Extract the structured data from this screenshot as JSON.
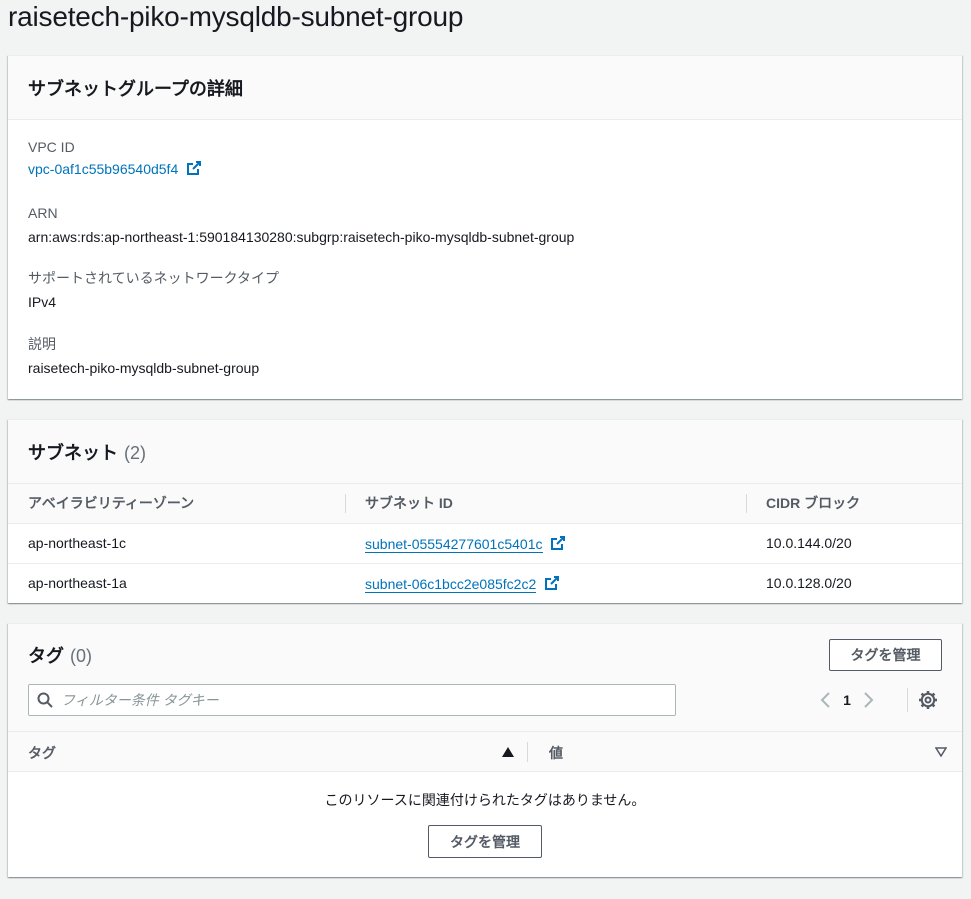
{
  "page": {
    "title": "raisetech-piko-mysqldb-subnet-group"
  },
  "details": {
    "title": "サブネットグループの詳細",
    "vpc_label": "VPC ID",
    "vpc_value": "vpc-0af1c55b96540d5f4",
    "arn_label": "ARN",
    "arn_value": "arn:aws:rds:ap-northeast-1:590184130280:subgrp:raisetech-piko-mysqldb-subnet-group",
    "network_label": "サポートされているネットワークタイプ",
    "network_value": "IPv4",
    "desc_label": "説明",
    "desc_value": "raisetech-piko-mysqldb-subnet-group"
  },
  "subnets": {
    "title": "サブネット",
    "count": "(2)",
    "columns": [
      "アベイラビリティーゾーン",
      "サブネット ID",
      "CIDR ブロック"
    ],
    "rows": [
      {
        "az": "ap-northeast-1c",
        "id": "subnet-05554277601c5401c",
        "cidr": "10.0.144.0/20"
      },
      {
        "az": "ap-northeast-1a",
        "id": "subnet-06c1bcc2e085fc2c2",
        "cidr": "10.0.128.0/20"
      }
    ]
  },
  "tags": {
    "title": "タグ",
    "count": "(0)",
    "manage_label": "タグを管理",
    "search_placeholder": "フィルター条件 タグキー",
    "page_number": "1",
    "col_key": "タグ",
    "col_value": "値",
    "empty_message": "このリソースに関連付けられたタグはありません。",
    "empty_manage_label": "タグを管理"
  },
  "icons": {
    "external": "external-link-icon",
    "search": "search-icon",
    "prev": "chevron-left-icon",
    "next": "chevron-right-icon",
    "settings": "gear-icon",
    "sort_up": "sort-ascending-icon",
    "sort_down": "sort-descending-icon"
  },
  "colors": {
    "link": "#0073bb",
    "background": "#f2f3f3",
    "text": "#16191f"
  }
}
